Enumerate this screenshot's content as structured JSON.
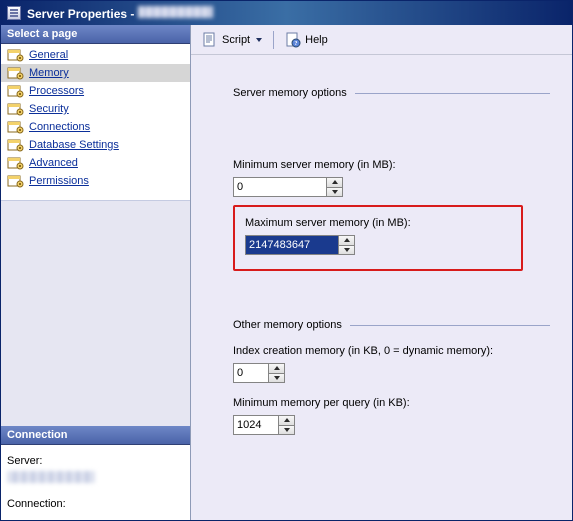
{
  "window": {
    "title_prefix": "Server Properties -"
  },
  "toolbar": {
    "script_label": "Script",
    "help_label": "Help"
  },
  "sidebar": {
    "select_header": "Select a page",
    "items": [
      {
        "label": "General"
      },
      {
        "label": "Memory"
      },
      {
        "label": "Processors"
      },
      {
        "label": "Security"
      },
      {
        "label": "Connections"
      },
      {
        "label": "Database Settings"
      },
      {
        "label": "Advanced"
      },
      {
        "label": "Permissions"
      }
    ],
    "connection_header": "Connection",
    "server_label": "Server:",
    "connection_label": "Connection:"
  },
  "content": {
    "group1_title": "Server memory options",
    "min_mem_label": "Minimum server memory (in MB):",
    "min_mem_value": "0",
    "max_mem_label": "Maximum server memory (in MB):",
    "max_mem_value": "2147483647",
    "group2_title": "Other memory options",
    "index_mem_label": "Index creation memory (in KB, 0 = dynamic memory):",
    "index_mem_value": "0",
    "min_query_label": "Minimum memory per query (in KB):",
    "min_query_value": "1024"
  }
}
